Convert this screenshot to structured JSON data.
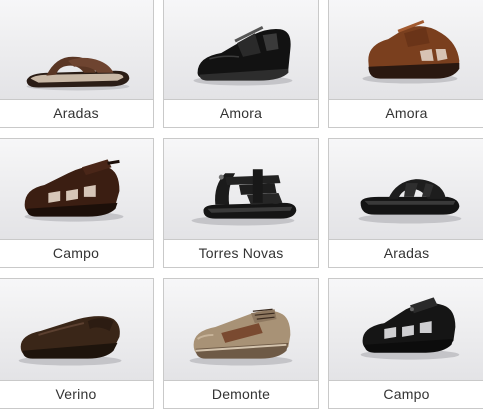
{
  "products": [
    {
      "name": "Aradas",
      "icon": "brown-slide-sandal-icon"
    },
    {
      "name": "Amora",
      "icon": "black-closed-sandal-icon"
    },
    {
      "name": "Amora",
      "icon": "brown-closed-sandal-icon"
    },
    {
      "name": "Campo",
      "icon": "brown-fisherman-sandal-icon"
    },
    {
      "name": "Torres Novas",
      "icon": "black-strap-sandal-icon"
    },
    {
      "name": "Aradas",
      "icon": "black-slide-sandal-icon"
    },
    {
      "name": "Verino",
      "icon": "brown-loafer-icon"
    },
    {
      "name": "Demonte",
      "icon": "beige-sneaker-icon"
    },
    {
      "name": "Campo",
      "icon": "black-fisherman-sandal-icon"
    }
  ],
  "colors": {
    "border": "#c9c9c9",
    "text": "#333333"
  }
}
